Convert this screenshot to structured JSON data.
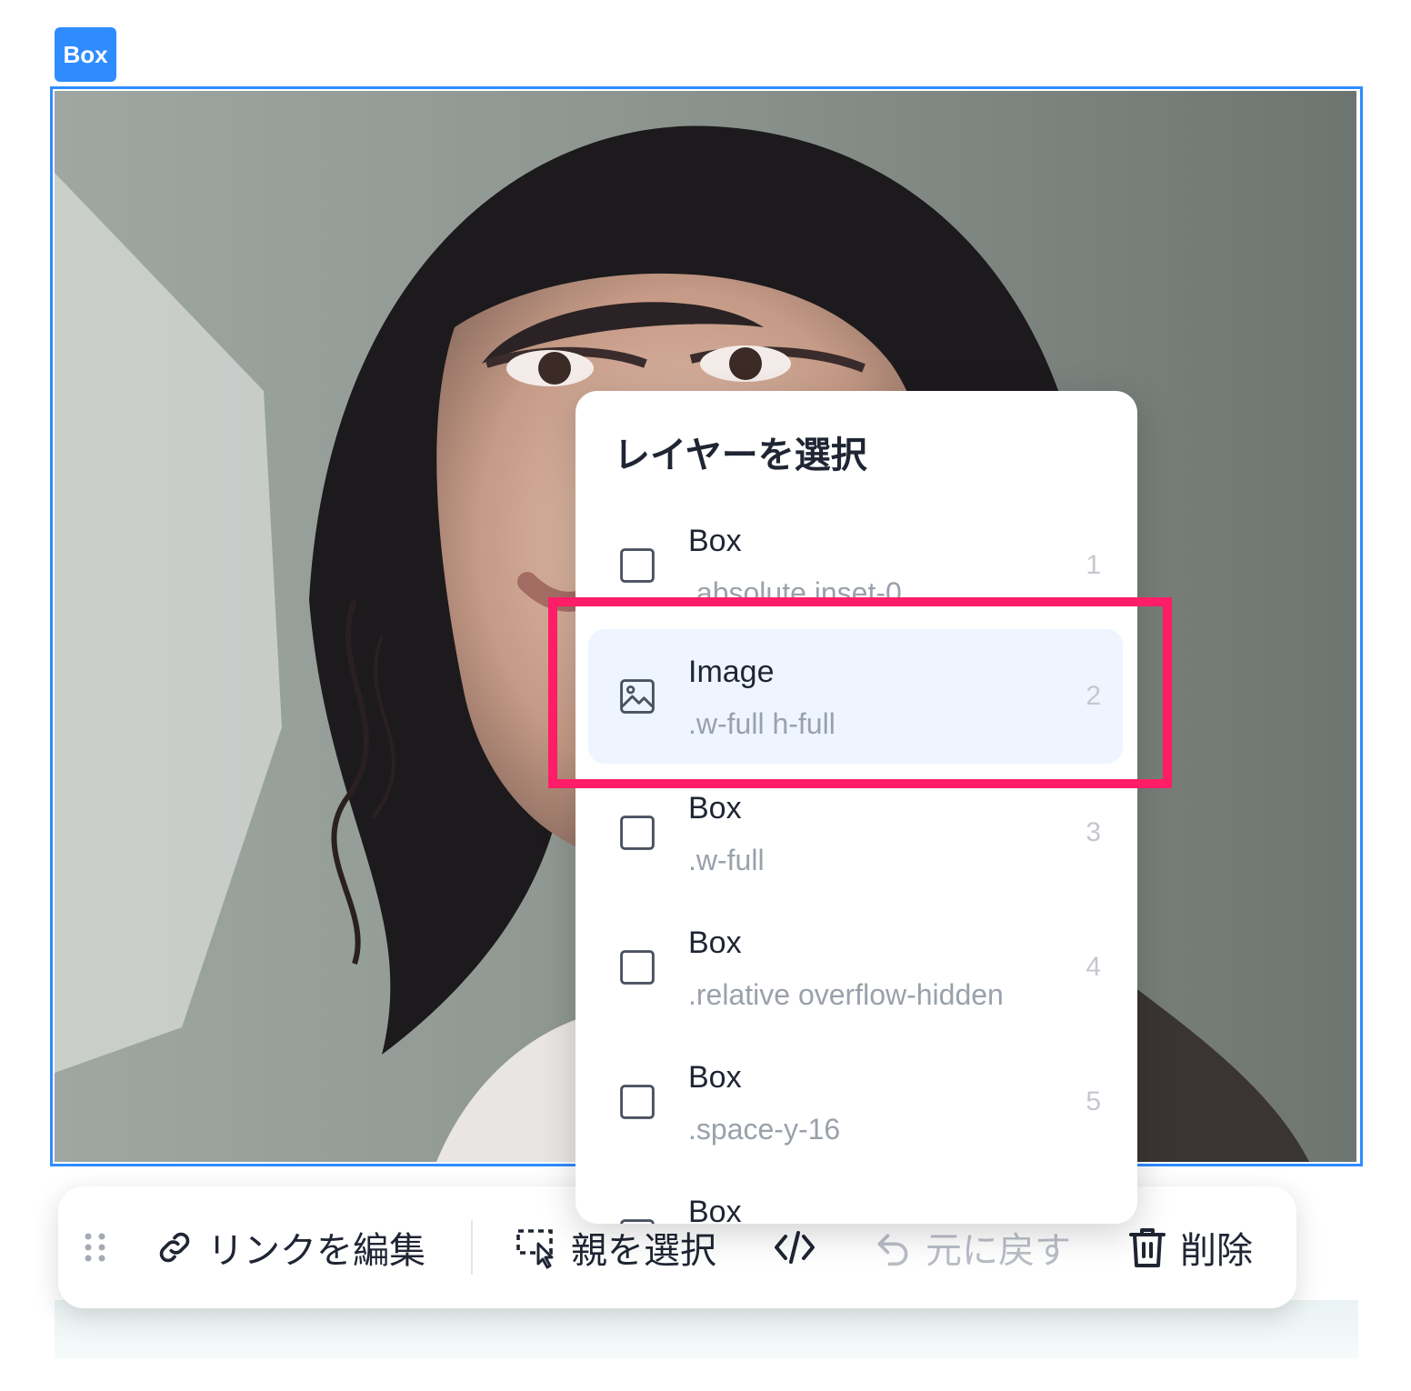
{
  "box_tag": {
    "label": "Box"
  },
  "layer_menu": {
    "title": "レイヤーを選択",
    "items": [
      {
        "name": "Box",
        "classes": ".absolute inset-0",
        "index": "1",
        "icon": "box-icon",
        "active": false
      },
      {
        "name": "Image",
        "classes": ".w-full h-full",
        "index": "2",
        "icon": "image-icon",
        "active": true
      },
      {
        "name": "Box",
        "classes": ".w-full",
        "index": "3",
        "icon": "box-icon",
        "active": false
      },
      {
        "name": "Box",
        "classes": ".relative overflow-hidden",
        "index": "4",
        "icon": "box-icon",
        "active": false
      },
      {
        "name": "Box",
        "classes": ".space-y-16",
        "index": "5",
        "icon": "box-icon",
        "active": false
      },
      {
        "name": "Box",
        "classes": "",
        "index": "",
        "icon": "box-icon",
        "active": false
      }
    ]
  },
  "toolbar": {
    "edit_link": "リンクを編集",
    "select_parent": "親を選択",
    "undo": "元に戻す",
    "delete": "削除"
  },
  "colors": {
    "accent": "#2f8cff",
    "highlight": "#ff1d68",
    "active_row": "#eef5ff"
  }
}
